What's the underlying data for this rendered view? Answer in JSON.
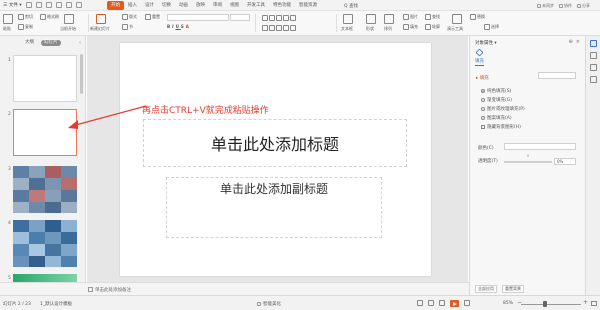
{
  "menubar": {
    "file_label": "三 文件 ▾",
    "tabs": [
      "开始",
      "插入",
      "设计",
      "切换",
      "动画",
      "放映",
      "审阅",
      "视图",
      "开发工具",
      "特色功能",
      "智能资源"
    ],
    "active_tab": "开始",
    "search_label": "Q 查找",
    "right_items": [
      "未同步",
      "协作",
      "分享"
    ]
  },
  "toolbar": {
    "paste_label": "粘贴",
    "cut_label": "剪切",
    "copy_label": "复制",
    "format_label": "格式刷",
    "current_slide_label": "当前开始",
    "new_slide_label": "新建幻灯片",
    "layout_label": "版式",
    "section_label": "节",
    "reset_label": "重置",
    "textbox_label": "文本框",
    "shape_label": "形状",
    "arrange_label": "排列",
    "image_label": "图片",
    "fill_label": "填充",
    "find_label": "查找",
    "outline_label": "轮廓",
    "present_label": "演示工具",
    "replace_label": "替换",
    "select_label": "选择"
  },
  "leftpanel": {
    "tabs": [
      "大纲",
      "幻灯片"
    ],
    "active_tab": "幻灯片",
    "slide_numbers": [
      "1",
      "2",
      "3",
      "4",
      "5"
    ],
    "add_label": "+"
  },
  "slide": {
    "title_placeholder": "单击此处添加标题",
    "subtitle_placeholder": "单击此处添加副标题"
  },
  "annotation": {
    "text": "再点击CTRL+V就完成粘贴操作",
    "color": "#e53a2f"
  },
  "notes": {
    "placeholder": "单击此处添加备注"
  },
  "rightpane": {
    "title": "对象属性 ▾",
    "tab_label": "填充",
    "section_label": "▸ 填充",
    "options": [
      "纯色填充(S)",
      "渐变填充(G)",
      "图片或纹理填充(P)",
      "图案填充(A)",
      "隐藏背景图形(H)"
    ],
    "color_label": "颜色(C)",
    "transparency_label": "透明度(T)",
    "transparency_value": "0%",
    "apply_all_label": "全部应用",
    "reset_bg_label": "重置背景"
  },
  "statusbar": {
    "slide_counter": "幻灯片 2 / 23",
    "theme": "1_默认设计模板",
    "beautify_label": "智能美化",
    "zoom": "85%",
    "zoom_minus": "−",
    "zoom_plus": "+"
  },
  "colors": {
    "accent": "#e05b22",
    "link_blue": "#3c73c7",
    "selected_thumb_border": "#ef7a55"
  }
}
